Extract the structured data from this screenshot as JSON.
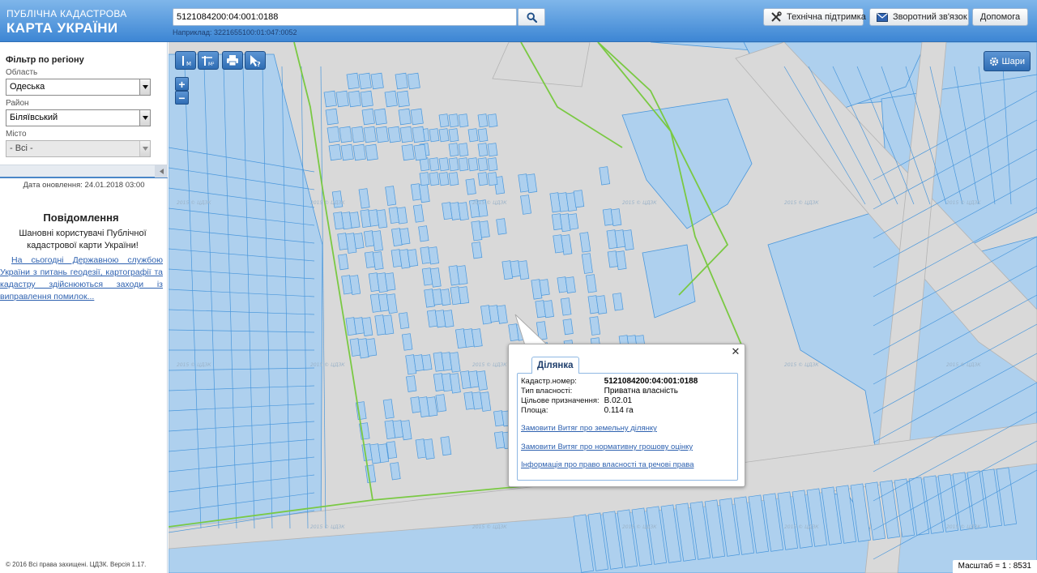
{
  "header": {
    "logo_line1": "ПУБЛІЧНА КАДАСТРОВА",
    "logo_line2": "КАРТА УКРАЇНИ",
    "search_value": "5121084200:04:001:0188",
    "search_hint": "Наприклад: 3221655100:01:047:0052",
    "buttons": {
      "support": "Технічна підтримка",
      "feedback": "Зворотний зв'язок",
      "help": "Допомога"
    }
  },
  "sidebar": {
    "filter_title": "Фільтр по регіону",
    "oblast_label": "Область",
    "oblast_value": "Одеська",
    "rayon_label": "Район",
    "rayon_value": "Біляївський",
    "city_label": "Місто",
    "city_value": "- Всі -",
    "update_date": "Дата оновлення: 24.01.2018 03:00",
    "notice_title": "Повідомлення",
    "notice_text": "Шановні користувачі Публічної кадастрової карти України!",
    "notice_link": "На сьогодні Державною службою України з питань геодезії, картографії та кадастру здійснюються заходи із виправлення помилок...",
    "copyright": "© 2016 Всі права захищені. ЦДЗК. Версія 1.17."
  },
  "map": {
    "layers_label": "Шари",
    "zoom_in": "+",
    "zoom_out": "−",
    "scale_text": "Масштаб = 1 : 8531",
    "watermark": "2015 © ЦДЗК",
    "colors": {
      "background": "#d9d9d9",
      "parcel_fill": "#aed0ee",
      "parcel_stroke": "#4a97db",
      "boundary": "#7ac943",
      "road": "#d9d9d9"
    }
  },
  "popup": {
    "tab_label": "Ділянка",
    "rows": [
      {
        "key": "Кадастр.номер:",
        "value": "5121084200:04:001:0188"
      },
      {
        "key": "Тип власності:",
        "value": "Приватна власність"
      },
      {
        "key": "Цільове призначення:",
        "value": "В.02.01"
      },
      {
        "key": "Площа:",
        "value": "0.114 га"
      }
    ],
    "links": [
      "Замовити Витяг про земельну ділянку",
      "Замовити Витяг про нормативну грошову оцінку",
      "Інформація про право власності та речові права"
    ]
  }
}
